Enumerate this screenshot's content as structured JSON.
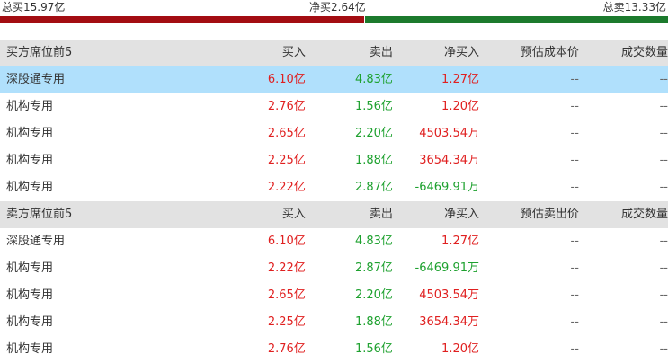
{
  "summary": {
    "total_buy": "总买15.97亿",
    "net_buy": "净买2.64亿",
    "total_sell": "总卖13.33亿",
    "buy_fraction": 0.545,
    "sell_fraction": 0.455
  },
  "buy_section": {
    "headers": [
      "买方席位前5",
      "买入",
      "卖出",
      "净买入",
      "预估成本价",
      "成交数量"
    ],
    "rows": [
      {
        "name": "深股通专用",
        "buy": "6.10亿",
        "sell": "4.83亿",
        "net": "1.27亿",
        "price": "--",
        "volume": "--",
        "highlight": true
      },
      {
        "name": "机构专用",
        "buy": "2.76亿",
        "sell": "1.56亿",
        "net": "1.20亿",
        "price": "--",
        "volume": "--"
      },
      {
        "name": "机构专用",
        "buy": "2.65亿",
        "sell": "2.20亿",
        "net": "4503.54万",
        "price": "--",
        "volume": "--"
      },
      {
        "name": "机构专用",
        "buy": "2.25亿",
        "sell": "1.88亿",
        "net": "3654.34万",
        "price": "--",
        "volume": "--"
      },
      {
        "name": "机构专用",
        "buy": "2.22亿",
        "sell": "2.87亿",
        "net": "-6469.91万",
        "price": "--",
        "volume": "--"
      }
    ]
  },
  "sell_section": {
    "headers": [
      "卖方席位前5",
      "买入",
      "卖出",
      "净买入",
      "预估卖出价",
      "成交数量"
    ],
    "rows": [
      {
        "name": "深股通专用",
        "buy": "6.10亿",
        "sell": "4.83亿",
        "net": "1.27亿",
        "price": "--",
        "volume": "--"
      },
      {
        "name": "机构专用",
        "buy": "2.22亿",
        "sell": "2.87亿",
        "net": "-6469.91万",
        "price": "--",
        "volume": "--"
      },
      {
        "name": "机构专用",
        "buy": "2.65亿",
        "sell": "2.20亿",
        "net": "4503.54万",
        "price": "--",
        "volume": "--"
      },
      {
        "name": "机构专用",
        "buy": "2.25亿",
        "sell": "1.88亿",
        "net": "3654.34万",
        "price": "--",
        "volume": "--"
      },
      {
        "name": "机构专用",
        "buy": "2.76亿",
        "sell": "1.56亿",
        "net": "1.20亿",
        "price": "--",
        "volume": "--"
      }
    ]
  },
  "colors": {
    "buy_bar": "#a30d12",
    "sell_bar": "#1c7a2d",
    "buy_text": "#e02020",
    "sell_text": "#1ea12f",
    "header_bg": "#e2e2e2",
    "highlight_bg": "#b0e0fc"
  }
}
